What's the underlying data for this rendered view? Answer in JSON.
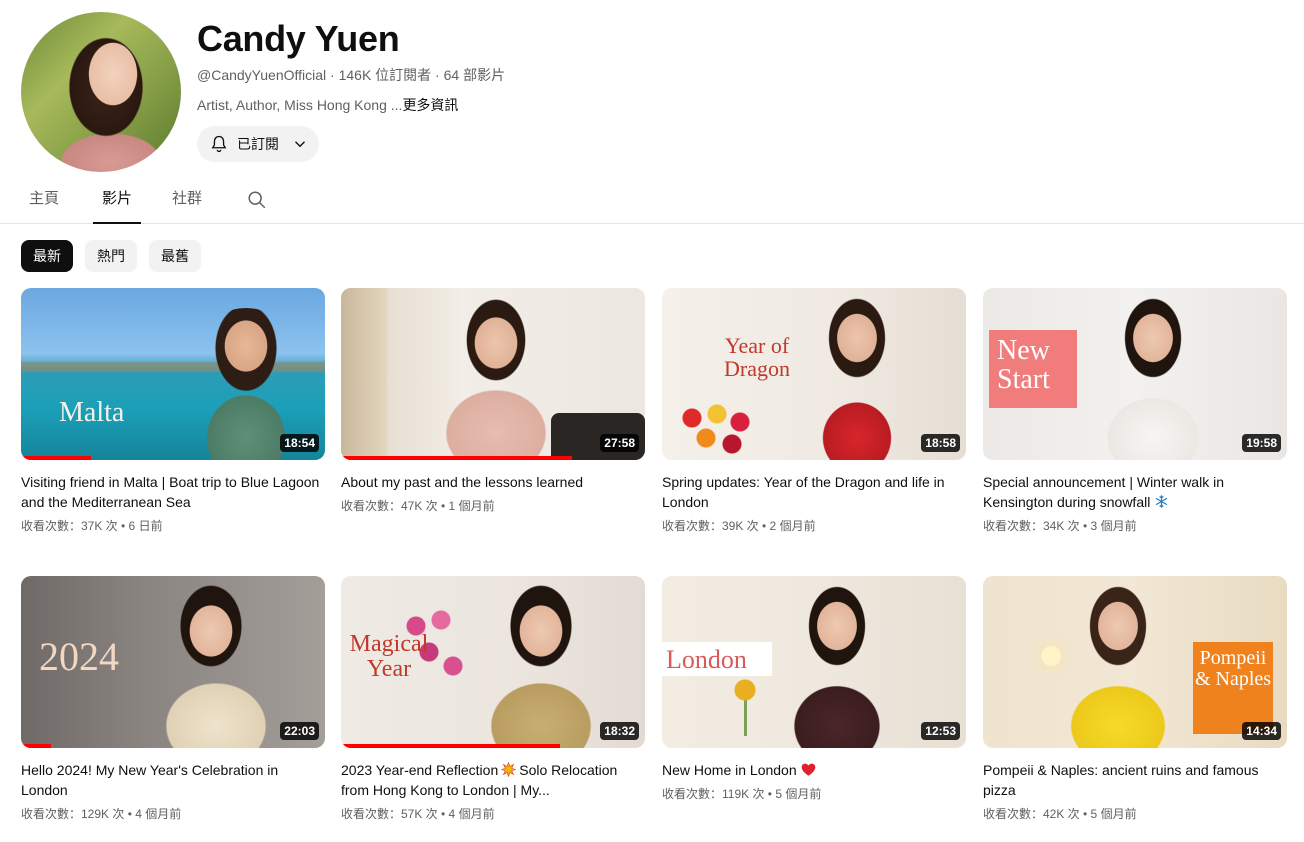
{
  "channel": {
    "name": "Candy Yuen",
    "meta": "@CandyYuenOfficial · 146K 位訂閱者 · 64 部影片",
    "description": "Artist, Author, Miss Hong Kong ...",
    "more_label": "更多資訊",
    "subscribed_label": "已訂閱"
  },
  "tabs": [
    {
      "label": "主頁"
    },
    {
      "label": "影片"
    },
    {
      "label": "社群"
    }
  ],
  "chips": [
    {
      "label": "最新"
    },
    {
      "label": "熱門"
    },
    {
      "label": "最舊"
    }
  ],
  "videos": [
    {
      "title": "Visiting friend in Malta | Boat trip to Blue Lagoon and the Mediterranean Sea",
      "meta": "收看次數：37K 次 • 6 日前",
      "duration": "18:54",
      "thumb_text": "Malta",
      "progress": 0.23
    },
    {
      "title": "About my past and the lessons learned",
      "meta": "收看次數：47K 次 • 1 個月前",
      "duration": "27:58",
      "thumb_text": "",
      "progress": 0.76
    },
    {
      "title": "Spring updates: Year of the Dragon and life in London",
      "meta": "收看次數：39K 次 • 2 個月前",
      "duration": "18:58",
      "thumb_text": "Year of Dragon",
      "progress": 0
    },
    {
      "title": "Special announcement | Winter walk in Kensington during snowfall",
      "meta": "收看次數：34K 次 • 3 個月前",
      "duration": "19:58",
      "thumb_text": "New Start",
      "progress": 0,
      "emoji": "snowflake-icon"
    },
    {
      "title": "Hello 2024! My New Year's Celebration in London",
      "meta": "收看次數：129K 次 • 4 個月前",
      "duration": "22:03",
      "thumb_text": "2024",
      "progress": 0.1
    },
    {
      "title": "2023 Year-end Reflection",
      "title_rest": "Solo Relocation from Hong Kong to London | My...",
      "meta": "收看次數：57K 次 • 4 個月前",
      "duration": "18:32",
      "thumb_text": "Magical Year",
      "progress": 0.72,
      "emoji": "sparkle-burst-icon"
    },
    {
      "title": "New Home in London",
      "meta": "收看次數：119K 次 • 5 個月前",
      "duration": "12:53",
      "thumb_text": "London",
      "progress": 0,
      "emoji": "heart-icon"
    },
    {
      "title": "Pompeii & Naples: ancient ruins and famous pizza",
      "meta": "收看次數：42K 次 • 5 個月前",
      "duration": "14:34",
      "thumb_text": "Pompeii & Naples",
      "progress": 0
    }
  ],
  "colors": {
    "progress": "#ff0000",
    "text_primary": "#0f0f0f",
    "text_secondary": "#606060",
    "chip_bg": "#f2f2f2",
    "chip_active_bg": "#0f0f0f"
  }
}
